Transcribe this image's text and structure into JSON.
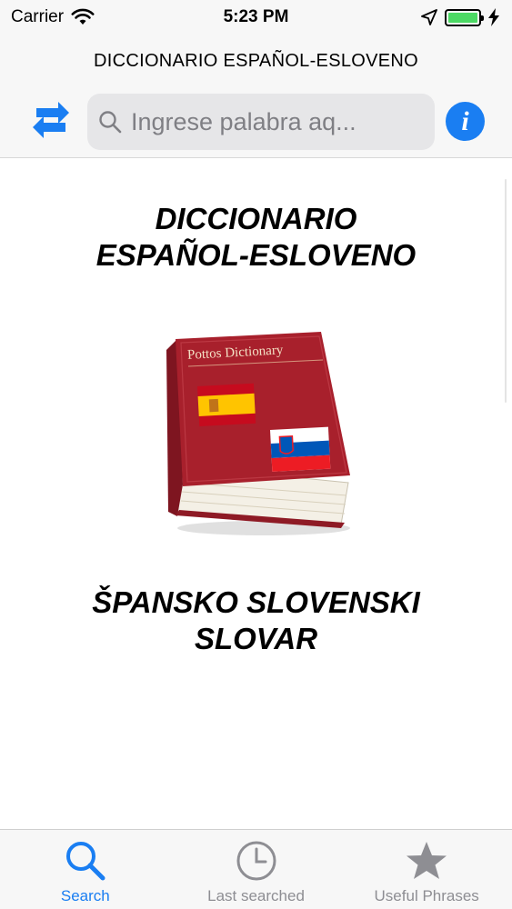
{
  "status_bar": {
    "carrier": "Carrier",
    "time": "5:23 PM",
    "battery_level": 1.0
  },
  "header": {
    "title": "DICCIONARIO ESPAÑOL-ESLOVENO",
    "search_placeholder": "Ingrese palabra aq...",
    "swap_icon": "swap-arrows-icon",
    "info_icon": "info-icon",
    "info_glyph": "i"
  },
  "main": {
    "heading_es": [
      "DICCIONARIO",
      "ESPAÑOL-ESLOVENO"
    ],
    "book_title": "Pottos Dictionary",
    "heading_sl": [
      "ŠPANSKO SLOVENSKI",
      "SLOVAR"
    ]
  },
  "tabs": [
    {
      "label": "Search",
      "icon": "search-icon",
      "active": true
    },
    {
      "label": "Last searched",
      "icon": "clock-icon",
      "active": false
    },
    {
      "label": "Useful Phrases",
      "icon": "star-icon",
      "active": false
    }
  ],
  "colors": {
    "accent": "#1a7ef2",
    "inactive": "#8e8e93",
    "battery": "#4cd964",
    "book": "#a8202c"
  }
}
